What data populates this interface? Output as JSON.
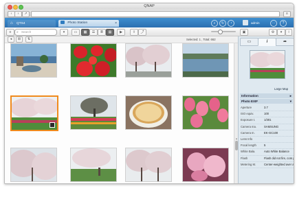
{
  "window": {
    "title": "QNAP"
  },
  "qts": {
    "home_tab": "QTS4",
    "app_tab": "Photo Station",
    "user_label": "admin"
  },
  "toolbar": {
    "search_placeholder": "Search"
  },
  "status": {
    "selected": "Selected: 1 , Total: 662"
  },
  "panel": {
    "tabs": [
      "",
      "i",
      ""
    ],
    "preview_caption": "Large Map",
    "information_label": "Information",
    "exif_label": "Photo EXIF",
    "exif": [
      {
        "k": "Aperture",
        "v": "3.7"
      },
      {
        "k": "ISO equiv.",
        "v": "100"
      },
      {
        "k": "Exposure t.",
        "v": "1/301"
      },
      {
        "k": "Camera ma.",
        "v": "SAMSUNG"
      },
      {
        "k": "Camera m.",
        "v": "EK-GC100"
      },
      {
        "k": "Lens Info",
        "v": ""
      },
      {
        "k": "Focal length",
        "v": "5"
      },
      {
        "k": "White Bala.",
        "v": "Auto White Balance"
      },
      {
        "k": "Flash",
        "v": "Flash did not fire, com pulsory flash mode"
      },
      {
        "k": "Metering M.",
        "v": "Center-weighted aver age"
      }
    ]
  },
  "photos": [
    {
      "name": "harbor-scene"
    },
    {
      "name": "strawberries"
    },
    {
      "name": "cherry-trees"
    },
    {
      "name": "lake-landscape"
    },
    {
      "name": "blossom-garden"
    },
    {
      "name": "tulip-field-tree"
    },
    {
      "name": "pizza"
    },
    {
      "name": "pink-tulips"
    },
    {
      "name": "blossom-sky"
    },
    {
      "name": "blossom-bench"
    },
    {
      "name": "blossom-grove"
    },
    {
      "name": "pink-lilies"
    }
  ],
  "colors": {
    "accent": "#f08a1c",
    "qts_blue": "#2f7cc0",
    "panel_bg": "#dfe9f0"
  }
}
